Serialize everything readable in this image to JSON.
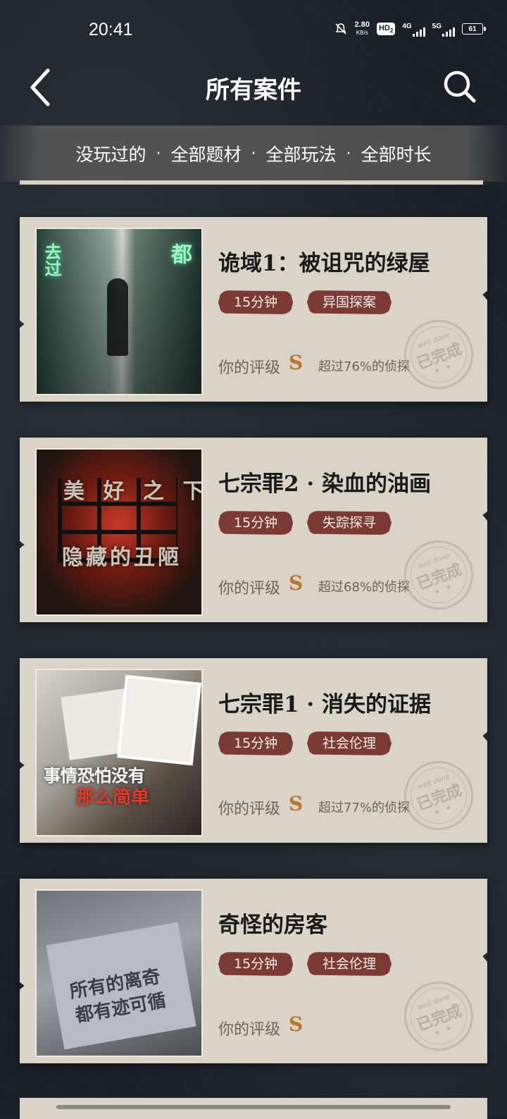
{
  "status_bar": {
    "time": "20:41",
    "net_speed": "2.80",
    "net_unit": "KB/s",
    "hd_badge": "HD",
    "hd_num": "2",
    "sig1": "4G",
    "sig2": "5G",
    "battery": "61"
  },
  "header": {
    "title": "所有案件"
  },
  "filters": [
    "没玩过的",
    "全部题材",
    "全部玩法",
    "全部时长"
  ],
  "filter_separator": "·",
  "rating_label": "你的评级",
  "stamp": {
    "top": "well done",
    "main": "已完成",
    "stars": "★ ★"
  },
  "cases": [
    {
      "title": "诡域1：被诅咒的绿屋",
      "duration": "15分钟",
      "genre": "异国探案",
      "grade": "S",
      "rank": "超过76%的侦探",
      "cover_text": "都",
      "cover_text2": "去过"
    },
    {
      "title": "七宗罪2 · 染血的油画",
      "duration": "15分钟",
      "genre": "失踪探寻",
      "grade": "S",
      "rank": "超过68%的侦探",
      "cover_text": "美 好 之 下",
      "cover_text2": "隐藏的丑陋"
    },
    {
      "title": "七宗罪1 · 消失的证据",
      "duration": "15分钟",
      "genre": "社会伦理",
      "grade": "S",
      "rank": "超过77%的侦探",
      "cover_text": "事情恐怕没有",
      "cover_text2": "那么简单"
    },
    {
      "title": "奇怪的房客",
      "duration": "15分钟",
      "genre": "社会伦理",
      "grade": "S",
      "rank": "",
      "cover_text": "所有的离奇",
      "cover_text2": "都有迹可循"
    }
  ]
}
